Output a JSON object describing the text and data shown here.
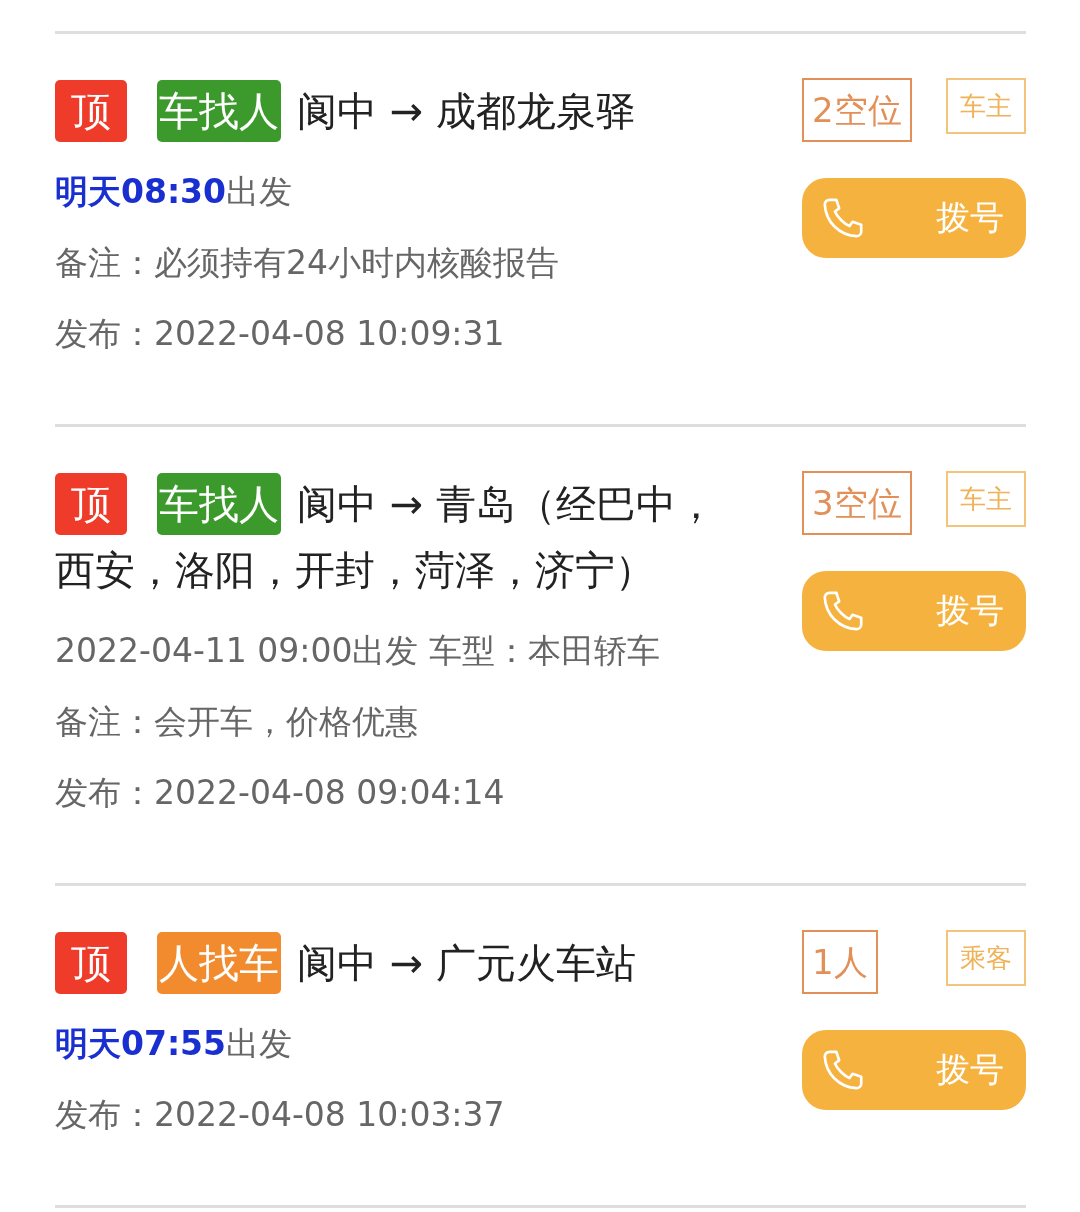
{
  "posts": [
    {
      "top_badge": "顶",
      "type": {
        "kind": "driver",
        "label": "车找人"
      },
      "route": "阆中 → 成都龙泉驿",
      "seats": "2空位",
      "role": "车主",
      "departure": {
        "highlight": "明天08:30",
        "text": "出发"
      },
      "note": "备注：必须持有24小时内核酸报告",
      "published": "发布：2022-04-08 10:09:31",
      "dial": "拨号"
    },
    {
      "top_badge": "顶",
      "type": {
        "kind": "driver",
        "label": "车找人"
      },
      "route": "阆中 → 青岛（经巴中，",
      "route_more": "西安，洛阳，开封，菏泽，济宁）",
      "seats": "3空位",
      "role": "车主",
      "departure": {
        "text": "2022-04-11 09:00出发 车型：本田轿车"
      },
      "note": "备注：会开车，价格优惠",
      "published": "发布：2022-04-08 09:04:14",
      "dial": "拨号"
    },
    {
      "top_badge": "顶",
      "type": {
        "kind": "passenger",
        "label": "人找车"
      },
      "route": "阆中 → 广元火车站",
      "seats": "1人",
      "role": "乘客",
      "departure": {
        "highlight": "明天07:55",
        "text": "出发"
      },
      "published": "发布：2022-04-08 10:03:37",
      "dial": "拨号"
    }
  ]
}
